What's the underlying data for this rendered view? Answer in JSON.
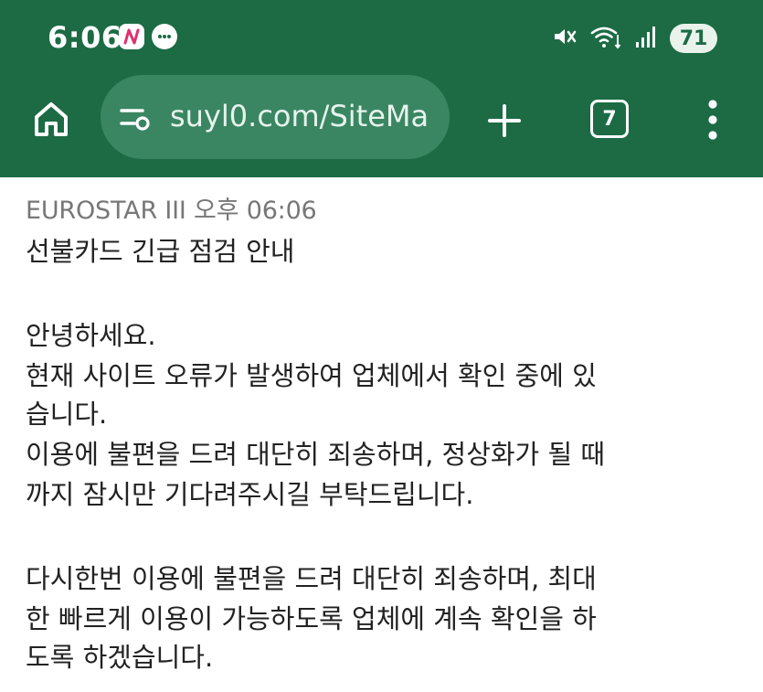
{
  "status_bar": {
    "time": "6:06",
    "battery": "71",
    "icons": [
      "messenger-icon",
      "chat-bubble-icon",
      "mute-icon",
      "wifi-icon",
      "signal-icon",
      "battery-icon"
    ]
  },
  "browser": {
    "url": "suyl0.com/SiteMa",
    "tab_count": "7",
    "icons": [
      "home-icon",
      "site-settings-icon",
      "plus-icon",
      "tabs-icon",
      "more-vert-icon"
    ],
    "accent_color": "#1c6b45",
    "urlbar_color": "#3a8663"
  },
  "message": {
    "sender_line": "EUROSTAR III 오후 06:06",
    "lines": [
      "선불카드 긴급 점검 안내",
      "",
      "안녕하세요.",
      "현재 사이트 오류가 발생하여 업체에서 확인 중에 있",
      "습니다.",
      "이용에 불편을 드려 대단히 죄송하며, 정상화가 될 때",
      "까지 잠시만 기다려주시길 부탁드립니다.",
      "",
      "다시한번 이용에 불편을 드려 대단히 죄송하며, 최대",
      "한 빠르게 이용이 가능하도록 업체에 계속 확인을 하",
      "도록 하겠습니다."
    ]
  }
}
